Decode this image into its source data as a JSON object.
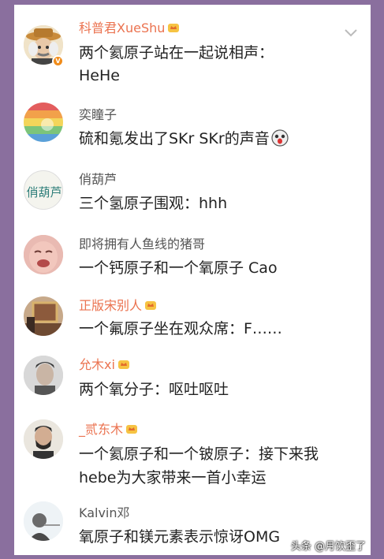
{
  "comments": [
    {
      "name": "科普君XueShu",
      "text": "两个氦原子站在一起说相声：",
      "text2": "HeHe",
      "vip": true,
      "verified": true
    },
    {
      "name": "奕瞳子",
      "text": "硫和氪发出了SKr SKr的声音",
      "vip": false
    },
    {
      "name": "俏葫芦",
      "text": "三个氢原子围观：hhh",
      "vip": false
    },
    {
      "name": "即将拥有人鱼线的猪哥",
      "text": "一个钙原子和一个氧原子  Cao",
      "vip": false
    },
    {
      "name": "正版宋别人",
      "text": "一个氟原子坐在观众席：F……",
      "vip": true
    },
    {
      "name": "允木xi",
      "text": "两个氧分子：呕吐呕吐",
      "vip": true
    },
    {
      "name": "_贰东木",
      "text": "一个氦原子和一个铍原子：接下来我",
      "text2": "hebe为大家带来一首小幸运",
      "vip": true
    },
    {
      "name": "Kalvin邓",
      "text": "氧原子和镁元素表示惊讶OMG",
      "vip": false
    }
  ],
  "avatar_labels": {
    "a3": "俏葫芦"
  },
  "watermark": "头条 @月饮歪了",
  "colors": {
    "background": "#8a6f9e",
    "vip_name": "#eb7350",
    "name": "#555555"
  }
}
